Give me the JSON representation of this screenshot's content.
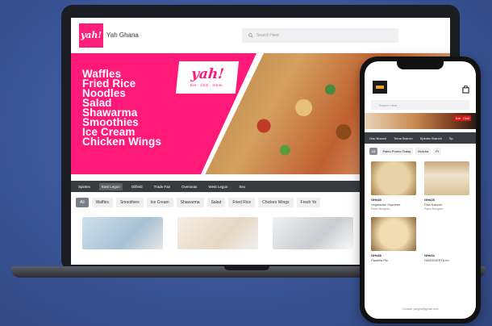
{
  "colors": {
    "brand_pink": "#ff1a7a",
    "bar_dark": "#383c42",
    "background": "#3a5596"
  },
  "web": {
    "logo_text": "yah!",
    "brand_name": "Yah Ghana",
    "search_placeholder": "Search Here",
    "search_icon": "search-icon",
    "hero": {
      "logo": "yah!",
      "tagline": "Eat . Chill . Smile",
      "menu_items": [
        "Waffles",
        "Fried Rice",
        "Noodles",
        "Salad",
        "Shawarma",
        "Smoothies",
        "Ice Cream",
        "Chicken Wings"
      ]
    },
    "category_bar": [
      "Spintex",
      "East Legon",
      "Oilfield",
      "Trade Fair",
      "Overseas",
      "West Legon",
      "Sex"
    ],
    "active_category_index": 1,
    "chips": [
      "All",
      "Waffles",
      "Smoothies",
      "Ice Cream",
      "Shawarma",
      "Salad",
      "Fried Rice",
      "Chicken Wings",
      "Fresh Yo"
    ],
    "active_chip_index": 0
  },
  "phone": {
    "search_placeholder": "Search Here",
    "banner_text": "Eat . Chill",
    "category_bar": [
      "Osu Branch",
      "Tema Branch",
      "Spintex Branch",
      "Sp"
    ],
    "chips": [
      "All",
      "Paleo Promo Today",
      "Mulcha",
      "Pr"
    ],
    "active_chip_index": 0,
    "items": [
      {
        "price": "GH¢45",
        "name": "Vegetarian Supreme",
        "sub": "Paleo Bangkim"
      },
      {
        "price": "GH¢28",
        "name": "Fisa Kabcoh",
        "sub": "Paleo Bangkim"
      },
      {
        "price": "GH¢38",
        "name": "Pastella Pie",
        "sub": "Paleo Bangkim"
      },
      {
        "price": "GH¢34",
        "name": "HARDIVERTA im",
        "sub": "Paleo Bangkim"
      }
    ],
    "footer_text": "Contact: yahgha@gmail.com"
  }
}
